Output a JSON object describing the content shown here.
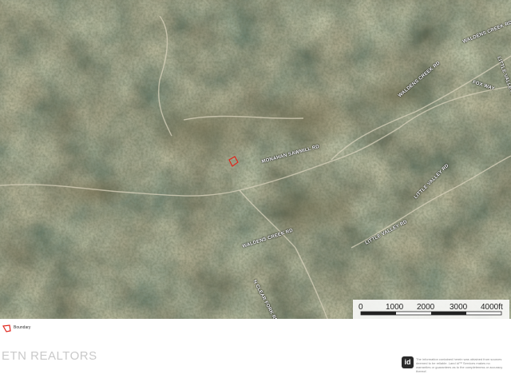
{
  "map": {
    "road_labels": [
      "WALDENS CREEK RD",
      "LITTLE VALLEY RD",
      "WALDENS CREEK RD",
      "FOX WAY",
      "MONAHAN SAWMILL RD",
      "LITTLE VALLEY RD",
      "LITTLE VALLEY RD",
      "WALDENS CREEK RD",
      "N CLEAR FORK RD"
    ],
    "scale": {
      "ticks": [
        "0",
        "1000",
        "2000",
        "3000",
        "4000ft"
      ]
    }
  },
  "legend": {
    "label": "Boundary",
    "boundary_color": "#e0251b"
  },
  "footer": {
    "brand": "ETN REALTORS",
    "badge": "id",
    "disclaimer": "The information contained herein was obtained from sources deemed to be reliable. Land id™ Services makes no warranties or guarantees as to the completeness or accuracy thereof."
  }
}
